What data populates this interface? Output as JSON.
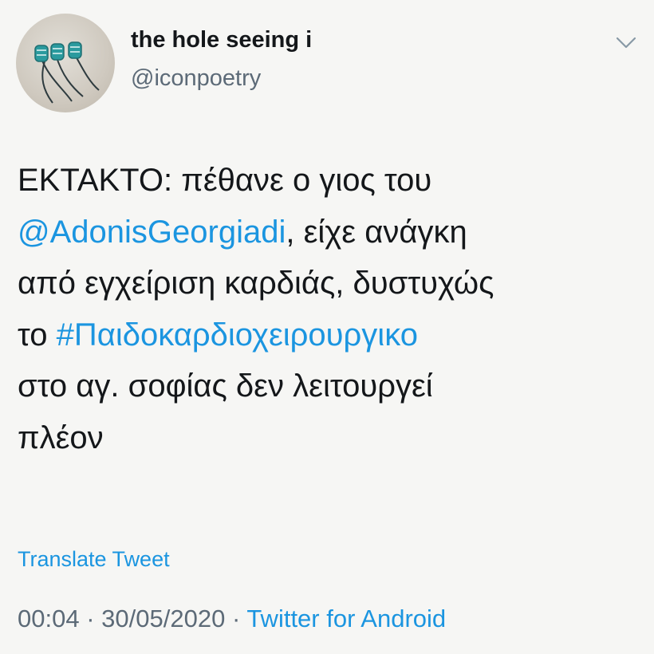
{
  "user": {
    "display_name": "the hole seeing i",
    "handle": "@iconpoetry"
  },
  "tweet": {
    "lines": [
      [
        {
          "text": "ΕΚΤΑΚΤΟ: πέθανε ο γιος του",
          "link": false
        }
      ],
      [
        {
          "text": "@AdonisGeorgiadi",
          "link": true
        },
        {
          "text": ", είχε ανάγκη",
          "link": false
        }
      ],
      [
        {
          "text": "από εγχείριση καρδιάς, δυστυχώς",
          "link": false
        }
      ],
      [
        {
          "text": "το ",
          "link": false
        },
        {
          "text": "#Παιδοκαρδιοχειρουργικο",
          "link": true
        }
      ],
      [
        {
          "text": "στο αγ. σοφίας δεν λειτουργεί",
          "link": false
        }
      ],
      [
        {
          "text": "πλέον",
          "link": false
        }
      ]
    ],
    "translate_label": "Translate Tweet",
    "time": "00:04",
    "separator": "·",
    "date": "30/05/2020",
    "source": "Twitter for Android"
  },
  "icons": {
    "avatar": "avatar-image",
    "menu": "chevron-down-icon"
  },
  "colors": {
    "link": "#1b95e0",
    "text": "#14171a",
    "secondary": "#5c6a77",
    "background": "#f6f6f4"
  }
}
